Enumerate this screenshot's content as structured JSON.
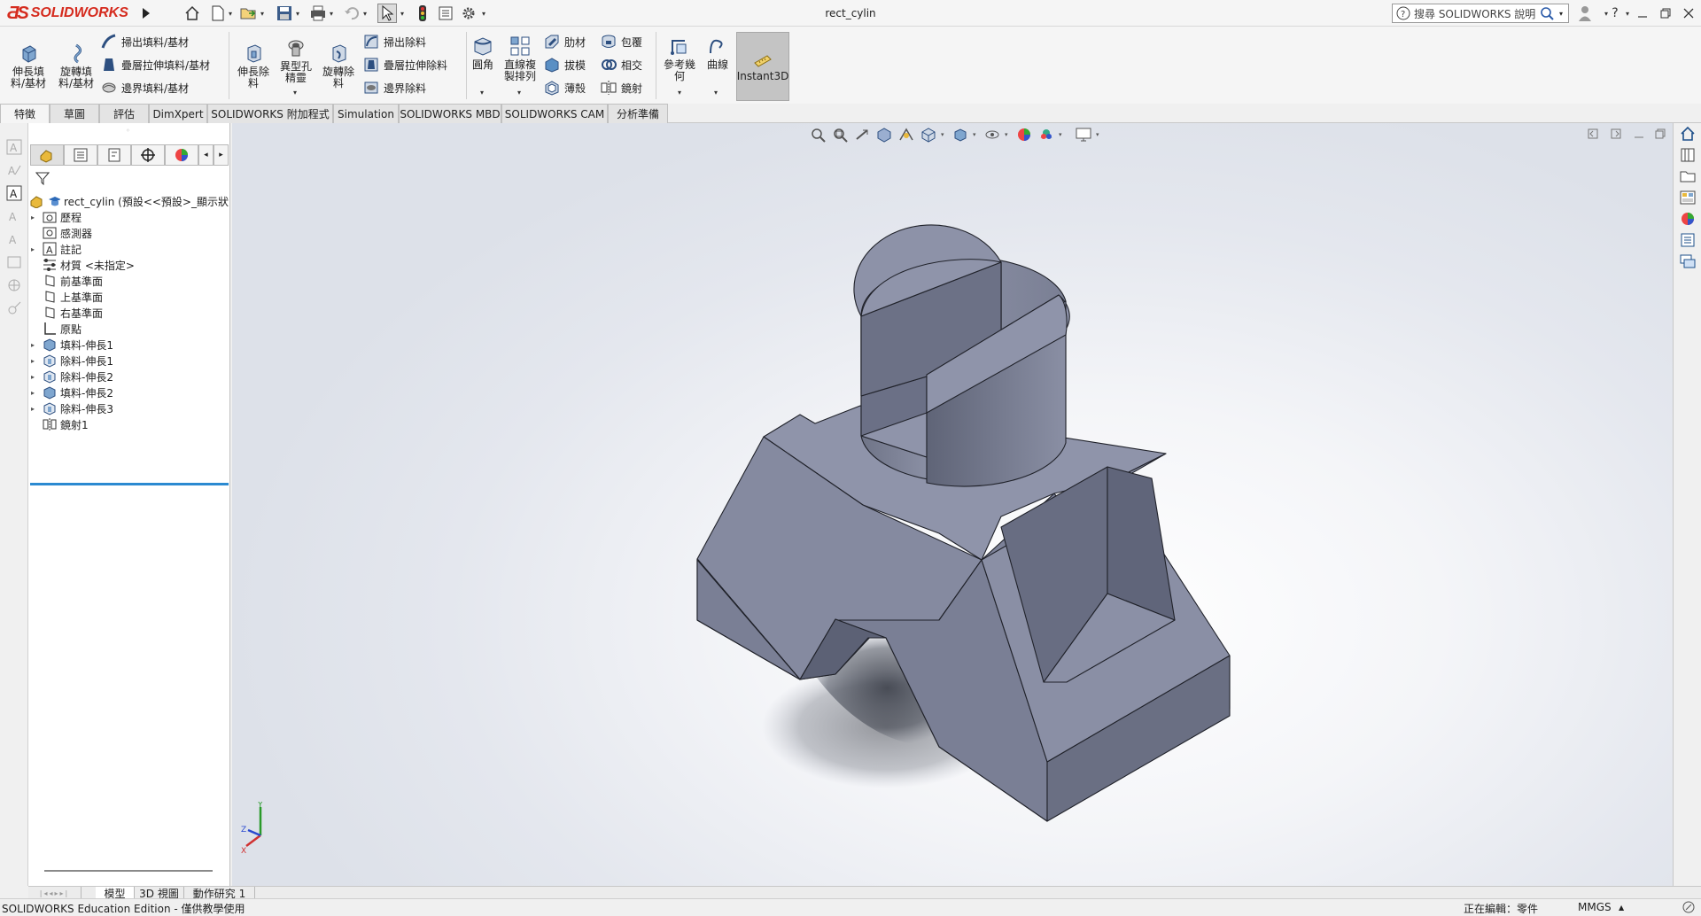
{
  "app": {
    "logo_text": "SOLIDWORKS",
    "document_title": "rect_cylin",
    "search_placeholder": "搜尋 SOLIDWORKS 說明",
    "brand_red": "#d52b1e",
    "accent_blue": "#2b8ad1",
    "model_color": "#8a8fa4"
  },
  "quick_access": [
    {
      "name": "home-icon"
    },
    {
      "name": "new-document-icon"
    },
    {
      "name": "open-icon"
    },
    {
      "name": "save-icon"
    },
    {
      "name": "print-icon"
    },
    {
      "name": "undo-icon"
    },
    {
      "name": "select-arrow-icon"
    },
    {
      "name": "rebuild-traffic-light-icon"
    },
    {
      "name": "file-properties-icon"
    },
    {
      "name": "options-gear-icon"
    }
  ],
  "window_controls": [
    "user-icon",
    "help-icon",
    "minimize-icon",
    "restore-icon",
    "close-icon"
  ],
  "ribbon": {
    "extruded_boss": "伸長填\n料/基材",
    "revolved_boss": "旋轉填\n料/基材",
    "swept_boss": "掃出填料/基材",
    "lofted_boss": "疊層拉伸填料/基材",
    "boundary_boss": "邊界填料/基材",
    "extruded_cut": "伸長除\n料",
    "hole_wizard": "異型孔\n精靈",
    "revolved_cut": "旋轉除\n料",
    "swept_cut": "掃出除料",
    "lofted_cut": "疊層拉伸除料",
    "boundary_cut": "邊界除料",
    "fillet": "圓角",
    "linear_pattern": "直線複\n製排列",
    "rib": "肋材",
    "draft": "拔模",
    "shell": "薄殼",
    "wrap": "包覆",
    "intersect": "相交",
    "mirror": "鏡射",
    "reference_geometry": "參考幾\n何",
    "curves": "曲線",
    "instant3d": "Instant3D"
  },
  "tabs": [
    {
      "label": "特徵",
      "active": true
    },
    {
      "label": "草圖",
      "active": false
    },
    {
      "label": "評估",
      "active": false
    },
    {
      "label": "DimXpert",
      "active": false
    },
    {
      "label": "SOLIDWORKS 附加程式",
      "active": false
    },
    {
      "label": "Simulation",
      "active": false
    },
    {
      "label": "SOLIDWORKS MBD",
      "active": false
    },
    {
      "label": "SOLIDWORKS CAM",
      "active": false
    },
    {
      "label": "分析準備",
      "active": false
    }
  ],
  "feature_tree": {
    "root": "rect_cylin  (預設<<預設>_顯示狀",
    "items": [
      {
        "label": "歷程",
        "icon": "history-folder-icon",
        "expandable": true
      },
      {
        "label": "感測器",
        "icon": "sensors-icon",
        "expandable": false
      },
      {
        "label": "註記",
        "icon": "annotations-icon",
        "expandable": true
      },
      {
        "label": "材質 <未指定>",
        "icon": "material-icon",
        "expandable": false
      },
      {
        "label": "前基準面",
        "icon": "plane-icon",
        "expandable": false
      },
      {
        "label": "上基準面",
        "icon": "plane-icon",
        "expandable": false
      },
      {
        "label": "右基準面",
        "icon": "plane-icon",
        "expandable": false
      },
      {
        "label": "原點",
        "icon": "origin-icon",
        "expandable": false
      },
      {
        "label": "填料-伸長1",
        "icon": "extrude-boss-icon",
        "expandable": true
      },
      {
        "label": "除料-伸長1",
        "icon": "extrude-cut-icon",
        "expandable": true
      },
      {
        "label": "除料-伸長2",
        "icon": "extrude-cut-icon",
        "expandable": true
      },
      {
        "label": "填料-伸長2",
        "icon": "extrude-boss-icon",
        "expandable": true
      },
      {
        "label": "除料-伸長3",
        "icon": "extrude-cut-icon",
        "expandable": true
      },
      {
        "label": "鏡射1",
        "icon": "mirror-feature-icon",
        "expandable": false
      }
    ]
  },
  "bottom_tabs": [
    {
      "label": "模型",
      "active": true
    },
    {
      "label": "3D 視圖",
      "active": false
    },
    {
      "label": "動作研究 1",
      "active": false
    }
  ],
  "status": {
    "edition": "SOLIDWORKS Education Edition - 僅供教學使用",
    "editing": "正在編輯：零件",
    "units": "MMGS",
    "units_arrow": "▲"
  },
  "triad": {
    "x": "X",
    "y": "Y",
    "z": "Z"
  }
}
